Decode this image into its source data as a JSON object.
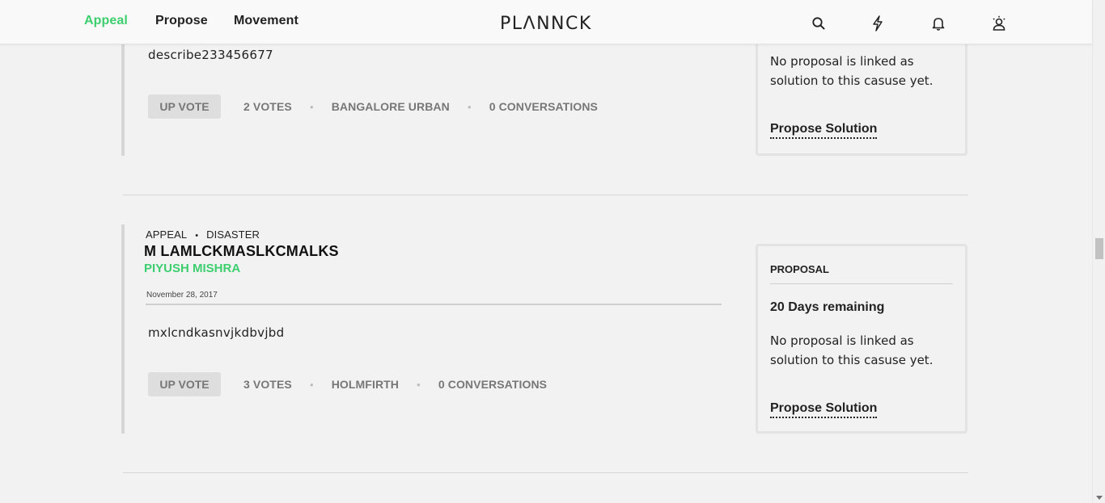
{
  "nav": {
    "links": [
      "Appeal",
      "Propose",
      "Movement"
    ],
    "active": "Appeal",
    "logo": "PLΛNNCK",
    "icons": [
      "search-icon",
      "lightning-icon",
      "bell-icon",
      "user-profile-icon"
    ],
    "accent_color": "#3dcf6e"
  },
  "cards": [
    {
      "description": "describe233456677",
      "upvote_label": "UP VOTE",
      "votes": "2 VOTES",
      "location": "BANGALORE URBAN",
      "conversations": "0 CONVERSATIONS",
      "panel": {
        "text": "No proposal is linked as solution to this casuse yet.",
        "link": "Propose Solution"
      }
    },
    {
      "type": "APPEAL",
      "category": "DISASTER",
      "title": "M LAMLCKMASLKCMALKS",
      "author": "PIYUSH MISHRA",
      "date": "November 28, 2017",
      "description": "mxlcndkasnvjkdbvjbd",
      "upvote_label": "UP VOTE",
      "votes": "3 VOTES",
      "location": "HOLMFIRTH",
      "conversations": "0 CONVERSATIONS",
      "panel": {
        "heading": "PROPOSAL",
        "days": "20 Days remaining",
        "text": "No proposal is linked as solution to this casuse yet.",
        "link": "Propose Solution"
      }
    }
  ]
}
